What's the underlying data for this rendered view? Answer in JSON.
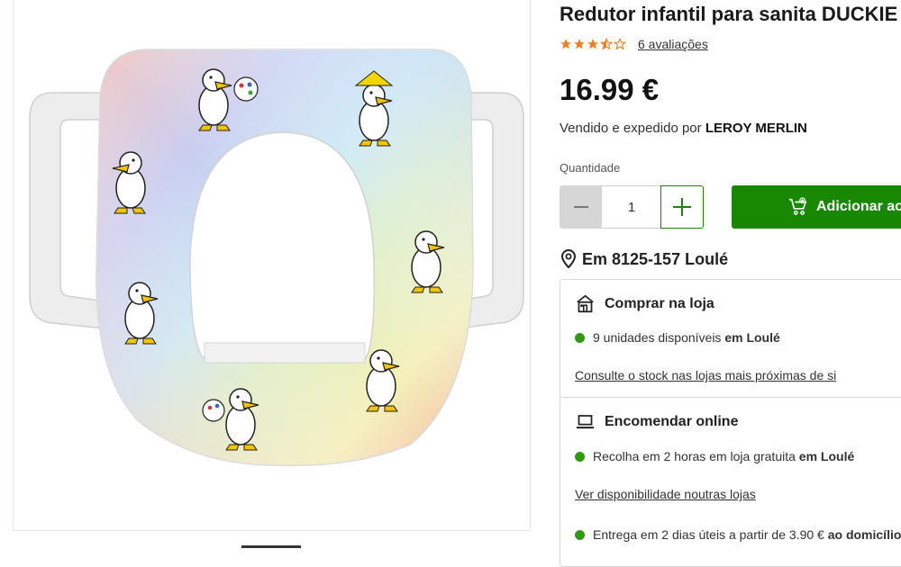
{
  "product": {
    "title": "Redutor infantil para sanita DUCKIE",
    "rating": 3.5,
    "reviews_label": "6 avaliações",
    "price": "16.99 €",
    "sold_by_prefix": "Vendido e expedido por",
    "sold_by": "LEROY MERLIN"
  },
  "quantity": {
    "label": "Quantidade",
    "value": "1"
  },
  "cart": {
    "add_label": "Adicionar ao"
  },
  "location": {
    "label": "Em 8125-157 Loulé"
  },
  "store": {
    "title": "Comprar na loja",
    "availability_text": "9 unidades disponíveis",
    "availability_place": "em Loulé",
    "link": "Consulte o stock nas lojas mais próximas de si"
  },
  "online": {
    "title": "Encomendar online",
    "pickup_text": "Recolha em 2 horas em loja gratuita",
    "pickup_place": "em Loulé",
    "link": "Ver disponibilidade noutras lojas",
    "delivery_text": "Entrega em 2 dias úteis a partir de 3.90 €",
    "delivery_place": "ao domicílio"
  },
  "colors": {
    "brand_green": "#188803",
    "available_dot": "#2f9a10",
    "star": "#ef7d1a"
  }
}
